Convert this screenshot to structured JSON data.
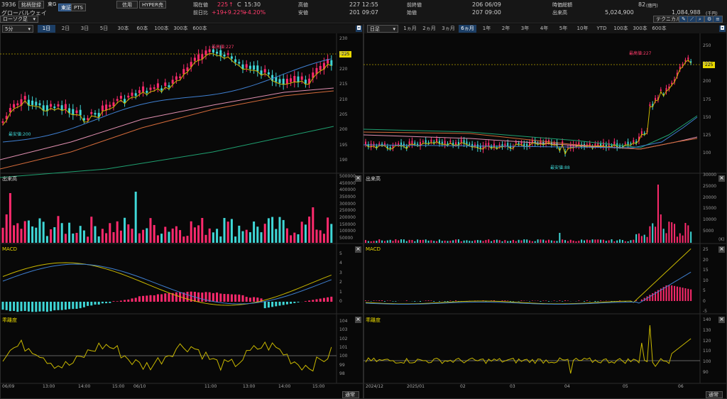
{
  "header": {
    "code": "3936",
    "tags": [
      "銘柄登録",
      "東G"
    ],
    "market_btn": "東証",
    "pts_btn": "PTS",
    "name": "グローバルウェイ",
    "credit_btn": "信用",
    "hyper_btn": "HYPER売",
    "current_label": "現在値",
    "current_value": "225",
    "current_arrow": "↑",
    "current_flag": "C",
    "current_time": "15:30",
    "prev_label": "前日比",
    "prev_change": "+19",
    "prev_change_pct": "+9.22%",
    "prev_change_pct2": "+4.20%",
    "high_label": "高値",
    "high_value": "227 12:55",
    "low_label": "安値",
    "low_value": "201 09:07",
    "prevclose_label": "前終値",
    "prevclose_value": "206 06/09",
    "open_label": "始値",
    "open_value": "207 09:00",
    "mktcap_label": "時価総額",
    "mktcap_value": "82",
    "mktcap_unit": "(億円)",
    "volume_label": "出来高",
    "volume_value": "5,024,900",
    "turnover_value": "1,084,988",
    "turnover_unit": "(千円)",
    "technical_btn": "テクニカル",
    "candle_select": "ローソク足"
  },
  "left": {
    "interval_select": "5分",
    "periods": [
      "1日",
      "2日",
      "3日",
      "5日",
      "30本",
      "60本",
      "100本",
      "300本",
      "600本"
    ],
    "active_period": "1日",
    "price_axis": [
      "230",
      "225",
      "220",
      "215",
      "210",
      "205",
      "200",
      "195",
      "190"
    ],
    "current_tag": "225",
    "high_note": "最高値:227",
    "low_note": "最安値:200",
    "volume_title": "出来高",
    "volume_axis": [
      "500000",
      "450000",
      "400000",
      "350000",
      "300000",
      "250000",
      "200000",
      "150000",
      "100000",
      "50000"
    ],
    "macd_title": "MACD",
    "macd_axis": [
      "5",
      "4",
      "3",
      "2",
      "1",
      "0"
    ],
    "dev_title": "乖離度",
    "dev_axis": [
      "104",
      "103",
      "102",
      "101",
      "100",
      "99",
      "98"
    ],
    "x_labels": [
      "06/09",
      "13:00",
      "14:00",
      "15:00",
      "06/10",
      "11:00",
      "13:00",
      "14:00",
      "15:00"
    ],
    "bottom_select": "通常"
  },
  "right": {
    "interval_select": "日足",
    "periods": [
      "1ヵ月",
      "2ヵ月",
      "3ヵ月",
      "6ヵ月",
      "1年",
      "2年",
      "3年",
      "4年",
      "5年",
      "10年",
      "YTD",
      "100本",
      "300本",
      "600本"
    ],
    "active_period": "6ヵ月",
    "price_axis": [
      "250",
      "225",
      "200",
      "175",
      "150",
      "125",
      "100"
    ],
    "current_tag": "225",
    "high_note": "最高値:227",
    "low_note": "最安値:88",
    "volume_title": "出来高",
    "volume_axis": [
      "30000",
      "25000",
      "20000",
      "15000",
      "10000",
      "5000"
    ],
    "volume_unit": "(K)",
    "macd_title": "MACD",
    "macd_axis": [
      "25",
      "20",
      "15",
      "10",
      "5",
      "0",
      "-5"
    ],
    "dev_title": "乖離度",
    "dev_axis": [
      "140",
      "130",
      "120",
      "110",
      "100",
      "90"
    ],
    "x_labels": [
      "2024/12",
      "2025/01",
      "02",
      "03",
      "04",
      "05",
      "06"
    ],
    "bottom_select": "通常"
  },
  "colors": {
    "up": "#ff2a6d",
    "down": "#3fd7d7",
    "ma1": "#c9b800",
    "ma2": "#3f7fd0",
    "ma3": "#d26a3a",
    "ma4": "#e08fb0",
    "ma5": "#1fa070",
    "accent": "#2d4f7a"
  }
}
